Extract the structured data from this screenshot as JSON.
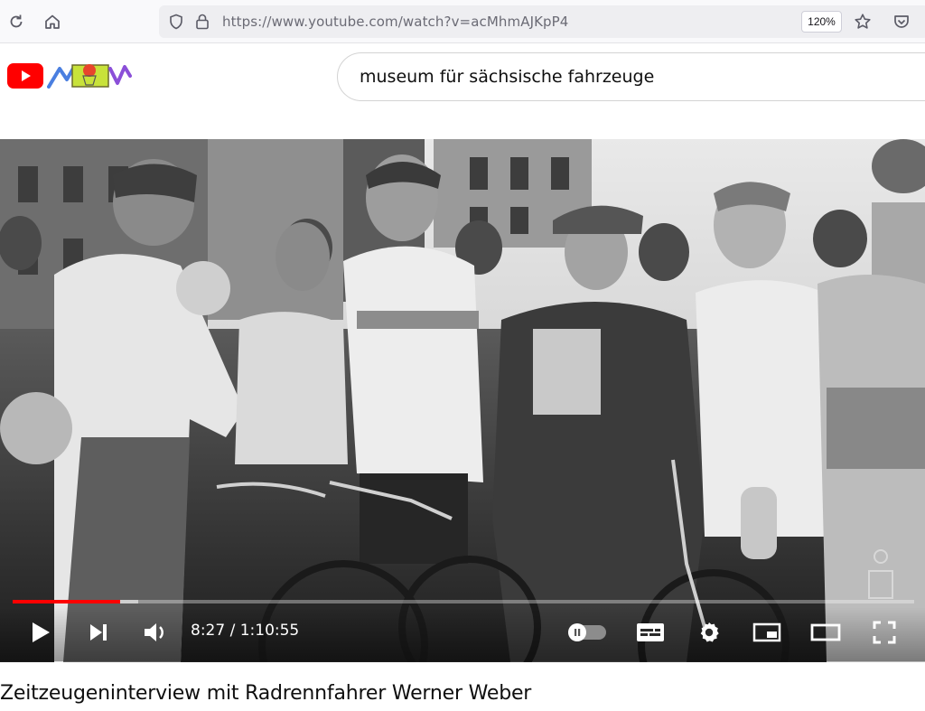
{
  "browser": {
    "url": "https://www.youtube.com/watch?v=acMhmAJKpP4",
    "zoom": "120%"
  },
  "search": {
    "query": "museum für sächsische fahrzeuge"
  },
  "player": {
    "time": "8:27 / 1:10:55",
    "progress_fraction": 0.119,
    "buffer_fraction": 0.139,
    "accent_color": "#ff0000",
    "autoplay_toggle": "off"
  },
  "video": {
    "title": "Zeitzeugeninterview mit Radrennfahrer Werner Weber"
  },
  "icons": {
    "reload": "reload-icon",
    "home": "home-icon",
    "shield": "shield-icon",
    "lock": "lock-icon",
    "bookmark": "star-icon",
    "pocket": "pocket-icon",
    "play": "play-icon",
    "next": "next-icon",
    "volume": "volume-icon",
    "subtitles": "subtitles-icon",
    "settings": "gear-icon",
    "miniplayer": "miniplayer-icon",
    "theater": "theater-icon",
    "fullscreen": "fullscreen-icon"
  }
}
